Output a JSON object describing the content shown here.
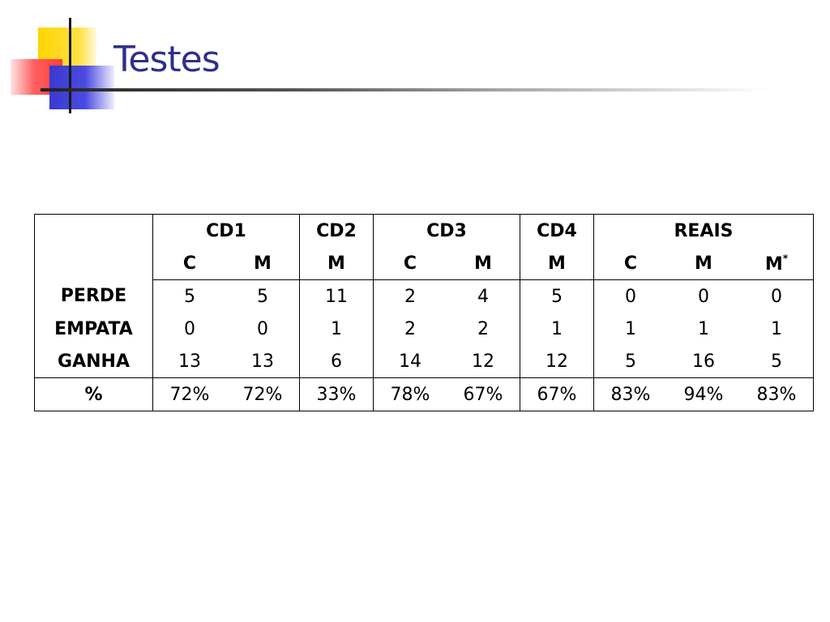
{
  "slide": {
    "title": "Testes"
  },
  "table": {
    "groups": [
      "CD1",
      "CD2",
      "CD3",
      "CD4",
      "REAIS"
    ],
    "subheaders": [
      "C",
      "M",
      "M",
      "C",
      "M",
      "M",
      "C",
      "M",
      "M"
    ],
    "last_subheader_mark": "*",
    "rows": [
      {
        "label": "PERDE",
        "values": [
          "5",
          "5",
          "11",
          "2",
          "4",
          "5",
          "0",
          "0",
          "0"
        ]
      },
      {
        "label": "EMPATA",
        "values": [
          "0",
          "0",
          "1",
          "2",
          "2",
          "1",
          "1",
          "1",
          "1"
        ]
      },
      {
        "label": "GANHA",
        "values": [
          "13",
          "13",
          "6",
          "14",
          "12",
          "12",
          "5",
          "16",
          "5"
        ]
      },
      {
        "label": "%",
        "values": [
          "72%",
          "72%",
          "33%",
          "78%",
          "67%",
          "67%",
          "83%",
          "94%",
          "83%"
        ]
      }
    ]
  }
}
